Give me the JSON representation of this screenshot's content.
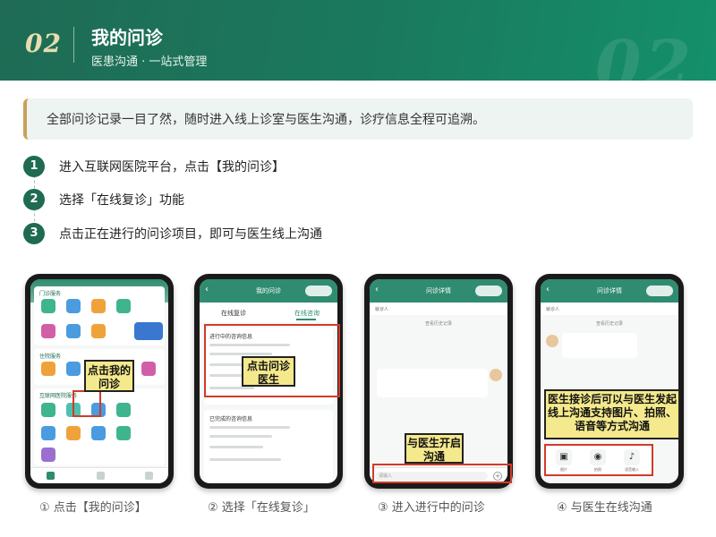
{
  "header": {
    "number": "02",
    "title": "我的问诊",
    "subtitle": "医患沟通 · 一站式管理",
    "ghost_number": "02"
  },
  "intro": "全部问诊记录一目了然，随时进入线上诊室与医生沟通，诊疗信息全程可追溯。",
  "steps": [
    {
      "num": "1",
      "text": "进入互联网医院平台，点击【我的问诊】"
    },
    {
      "num": "2",
      "text": "选择「在线复诊」功能"
    },
    {
      "num": "3",
      "text": "点击正在进行的问诊项目，即可与医生线上沟通"
    }
  ],
  "phones": [
    {
      "caption": "① 点击【我的问诊】",
      "callout": "点击我的问诊",
      "sections": [
        "门诊服务",
        "住院服务",
        "互联网医院服务"
      ]
    },
    {
      "caption": "② 选择「在线复诊」",
      "callout": "点击问诊医生",
      "header": "我的问诊",
      "tab_left": "在线复诊",
      "tab_right": "在线咨询",
      "card1_title": "进行中的咨询信息",
      "card2_title": "已完成的咨询信息"
    },
    {
      "caption": "③ 进入进行中的问诊",
      "callout": "与医生开启沟通",
      "header": "问诊详情",
      "patient": "就诊人",
      "history": "查看历史记录",
      "input_placeholder": "请输入"
    },
    {
      "caption": "④ 与医生在线沟通",
      "callout": "医生接诊后可以与医生发起线上沟通支持图片、拍照、语音等方式沟通",
      "header": "问诊详情",
      "patient": "就诊人",
      "history": "查看历史记录",
      "tools": [
        "图片",
        "拍照",
        "语音输入"
      ]
    }
  ],
  "colors": {
    "brand": "#1e6b52",
    "accent_gold": "#c9a15a",
    "callout": "#f4e98c",
    "highlight": "#d23a2a"
  }
}
